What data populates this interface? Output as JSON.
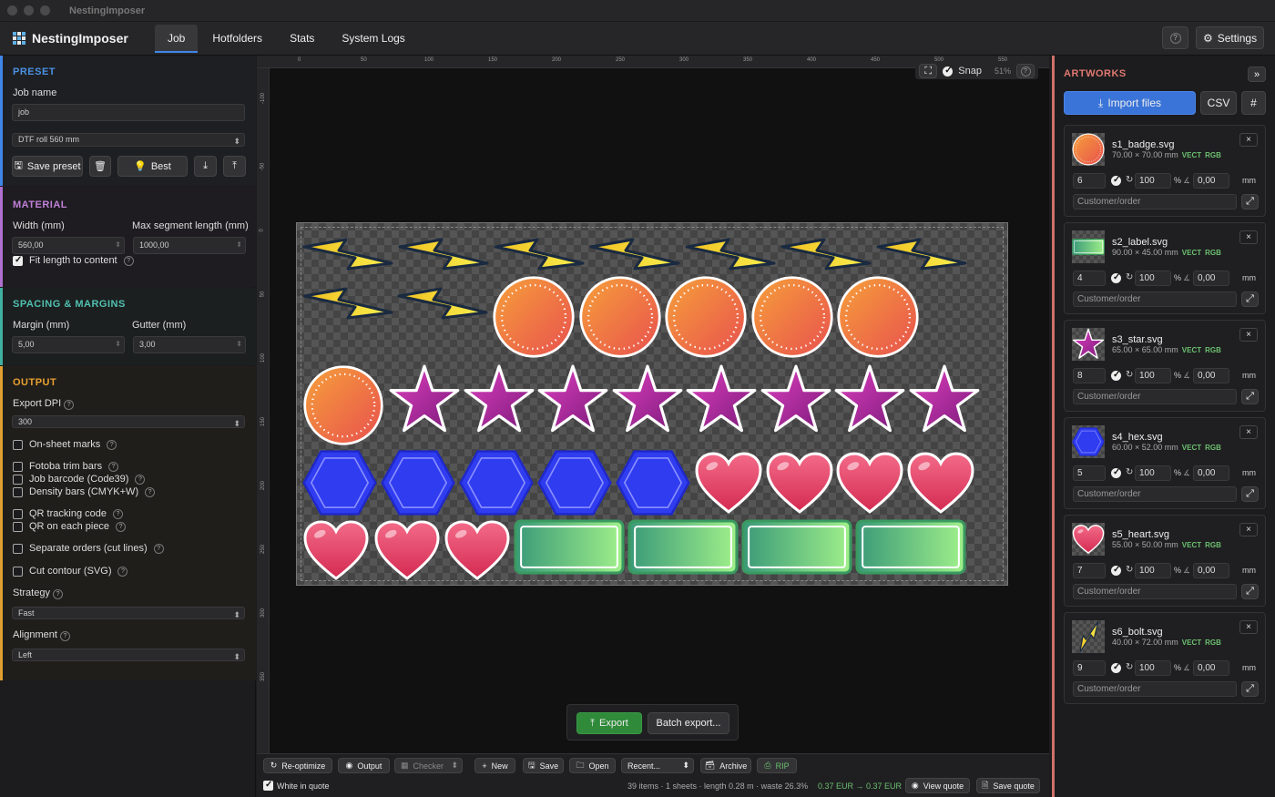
{
  "window": {
    "title": "NestingImposer"
  },
  "nav": {
    "app_name": "NestingImposer",
    "tabs": [
      "Job",
      "Hotfolders",
      "Stats",
      "System Logs"
    ],
    "help": "?",
    "settings": "Settings"
  },
  "preset": {
    "title": "PRESET",
    "job_name_label": "Job name",
    "job_name": "job",
    "preset_select": "DTF roll 560 mm",
    "save_preset": "Save preset",
    "best": "Best"
  },
  "material": {
    "title": "MATERIAL",
    "width_label": "Width (mm)",
    "width": "560,00",
    "max_seg_label": "Max segment length (mm)",
    "max_seg": "1000,00",
    "fit_length": "Fit length to content"
  },
  "spacing": {
    "title": "SPACING & MARGINS",
    "margin_label": "Margin (mm)",
    "margin": "5,00",
    "gutter_label": "Gutter (mm)",
    "gutter": "3,00"
  },
  "output": {
    "title": "OUTPUT",
    "dpi_label": "Export DPI",
    "dpi": "300",
    "on_sheet_marks": "On-sheet marks",
    "fotoba": "Fotoba trim bars",
    "barcode": "Job barcode (Code39)",
    "density": "Density bars (CMYK+W)",
    "qr_tracking": "QR tracking code",
    "qr_each": "QR on each piece",
    "separate": "Separate orders (cut lines)",
    "cut_contour": "Cut contour (SVG)",
    "strategy_label": "Strategy",
    "strategy": "Fast",
    "alignment_label": "Alignment",
    "alignment": "Left"
  },
  "canvas": {
    "snap": "Snap",
    "zoom": "51%",
    "help": "?",
    "ruler_h": [
      "0",
      "50",
      "100",
      "150",
      "200",
      "250",
      "300",
      "350",
      "400",
      "450",
      "500",
      "550"
    ],
    "ruler_v": [
      "-100",
      "-50",
      "0",
      "50",
      "100",
      "150",
      "200",
      "250",
      "300",
      "350"
    ],
    "export": "Export",
    "batch_export": "Batch export..."
  },
  "bottom": {
    "reoptimize": "Re-optimize",
    "output": "Output",
    "checker": "Checker",
    "new": "New",
    "save": "Save",
    "open": "Open",
    "recent": "Recent...",
    "archive": "Archive",
    "rip": "RIP",
    "white_in_quote": "White in quote",
    "stats": "39 items · 1 sheets · length 0.28 m · waste 26.3%",
    "price": "0.37 EUR → 0.37 EUR",
    "view_quote": "View quote",
    "save_quote": "Save quote"
  },
  "artworks": {
    "title": "ARTWORKS",
    "collapse": "»",
    "import": "Import files",
    "csv": "CSV",
    "hash": "#",
    "customer_placeholder": "Customer/order",
    "vect": "VECT",
    "rgb": "RGB",
    "pct": "%",
    "mm": "mm",
    "close": "×",
    "items": [
      {
        "name": "s1_badge.svg",
        "dims": "70.00 × 70.00 mm",
        "qty": "6",
        "scale": "100",
        "rot": "0,00"
      },
      {
        "name": "s2_label.svg",
        "dims": "90.00 × 45.00 mm",
        "qty": "4",
        "scale": "100",
        "rot": "0,00"
      },
      {
        "name": "s3_star.svg",
        "dims": "65.00 × 65.00 mm",
        "qty": "8",
        "scale": "100",
        "rot": "0,00"
      },
      {
        "name": "s4_hex.svg",
        "dims": "60.00 × 52.00 mm",
        "qty": "5",
        "scale": "100",
        "rot": "0,00"
      },
      {
        "name": "s5_heart.svg",
        "dims": "55.00 × 50.00 mm",
        "qty": "7",
        "scale": "100",
        "rot": "0,00"
      },
      {
        "name": "s6_bolt.svg",
        "dims": "40.00 × 72.00 mm",
        "qty": "9",
        "scale": "100",
        "rot": "0,00"
      }
    ]
  }
}
